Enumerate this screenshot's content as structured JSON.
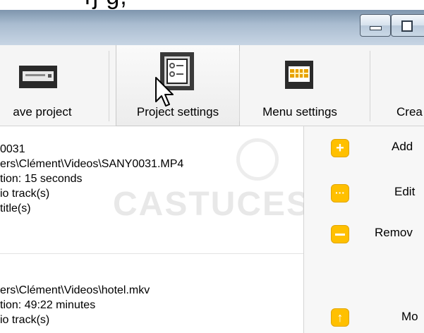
{
  "window": {
    "top_heading": "ŋ  g,"
  },
  "toolbar": {
    "save_label": "ave project",
    "project_settings_label": "Project settings",
    "menu_settings_label": "Menu settings",
    "create_label": "Crea"
  },
  "list": {
    "items": [
      {
        "lines": [
          "0031",
          "ers\\Clément\\Videos\\SANY0031.MP4",
          "tion: 15 seconds",
          "io track(s)",
          "title(s)"
        ]
      },
      {
        "lines": [
          "ers\\Clément\\Videos\\hotel.mkv",
          "tion: 49:22 minutes",
          "io track(s)"
        ]
      }
    ]
  },
  "watermark": "CASTUCES",
  "actions": {
    "add": "Add",
    "edit": "Edit",
    "remove": "Remov",
    "move": "Mo"
  },
  "icons": {
    "add": "plus-icon",
    "edit": "ellipsis-icon",
    "remove": "minus-icon",
    "move": "arrow-up-icon"
  },
  "colors": {
    "accent": "#ffc000"
  }
}
